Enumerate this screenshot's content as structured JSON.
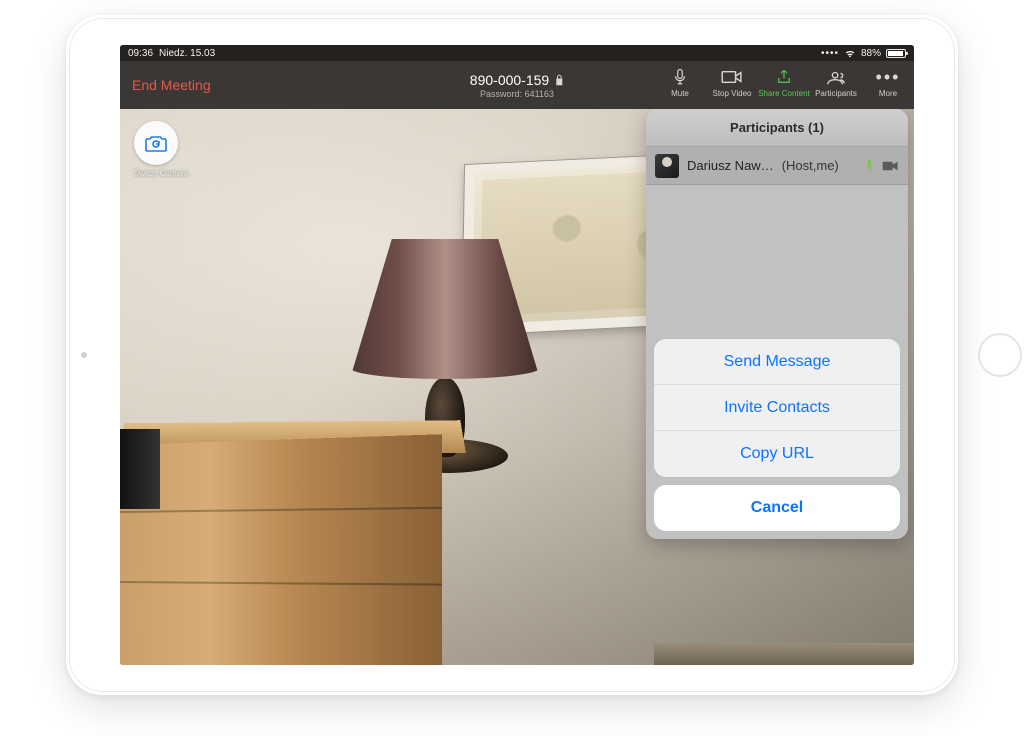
{
  "status": {
    "time": "09:36",
    "date": "Niedz. 15.03",
    "battery_pct": "88%"
  },
  "toolbar": {
    "end_label": "End Meeting",
    "meeting_id": "890-000-159",
    "password_label": "Password: 641163",
    "tools": {
      "mute": "Mute",
      "stop_video": "Stop Video",
      "share_content": "Share Content",
      "participants": "Participants",
      "more": "More"
    }
  },
  "switch_camera_label": "Switch Camera",
  "panel": {
    "title": "Participants (1)",
    "rows": [
      {
        "name": "Dariusz Naw…",
        "role": "(Host,me)"
      }
    ]
  },
  "sheet": {
    "options": [
      "Send Message",
      "Invite Contacts",
      "Copy URL"
    ],
    "cancel": "Cancel"
  }
}
